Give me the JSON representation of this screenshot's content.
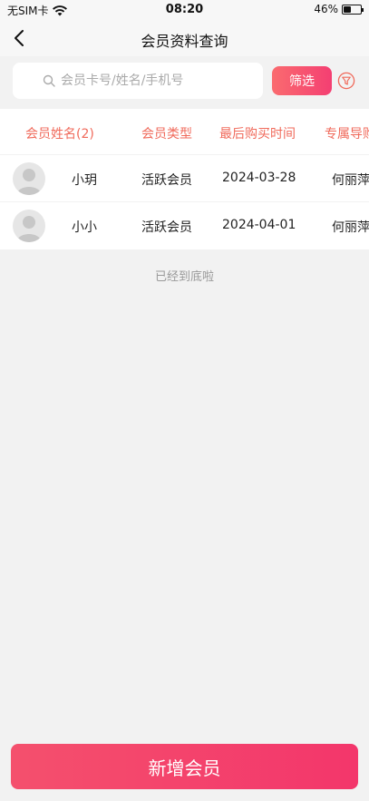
{
  "status_bar": {
    "carrier": "无SIM卡",
    "time": "08:20",
    "battery_text": "46%",
    "battery_level": 0.46
  },
  "nav": {
    "title": "会员资料查询"
  },
  "search": {
    "placeholder": "会员卡号/姓名/手机号",
    "filter_label": "筛选"
  },
  "table": {
    "headers": [
      "会员姓名(2)",
      "会员类型",
      "最后购买时间",
      "专属导购"
    ],
    "rows": [
      {
        "name": "小玥",
        "type": "活跃会员",
        "last_purchase": "2024-03-28",
        "guide": "何丽萍"
      },
      {
        "name": "小小",
        "type": "活跃会员",
        "last_purchase": "2024-04-01",
        "guide": "何丽萍"
      }
    ]
  },
  "list_end_text": "已经到底啦",
  "actions": {
    "add_member_label": "新增会员"
  }
}
